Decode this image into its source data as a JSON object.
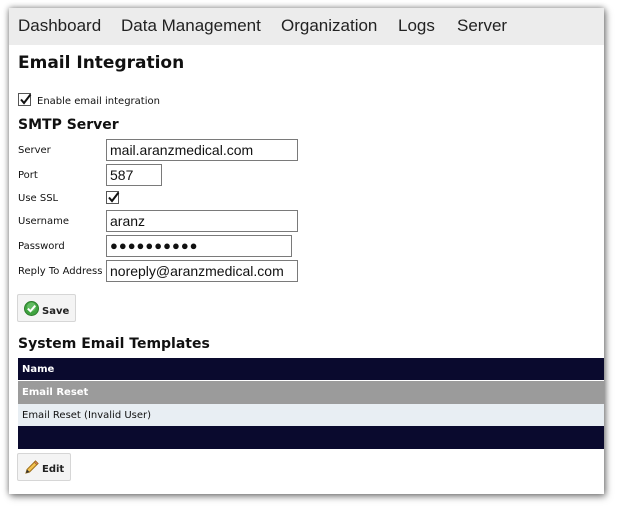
{
  "nav": {
    "items": [
      "Dashboard",
      "Data Management",
      "Organization",
      "Logs",
      "Server"
    ]
  },
  "page": {
    "title": "Email Integration"
  },
  "enable": {
    "label": "Enable email integration",
    "checked": true
  },
  "smtp": {
    "title": "SMTP Server",
    "server_label": "Server",
    "server_value": "mail.aranzmedical.com",
    "port_label": "Port",
    "port_value": "587",
    "ssl_label": "Use SSL",
    "ssl_checked": true,
    "username_label": "Username",
    "username_value": "aranz",
    "password_label": "Password",
    "password_value": "●●●●●●●●●●",
    "reply_label": "Reply To Address",
    "reply_value": "noreply@aranzmedical.com"
  },
  "save_button": {
    "label": "Save",
    "icon": "checkmark-circle-icon",
    "icon_color": "#3fa33f"
  },
  "templates": {
    "title": "System Email Templates",
    "column": "Name",
    "rows": [
      "Email Reset",
      "Email Reset (Invalid User)"
    ],
    "selected_index": 0
  },
  "edit_button": {
    "label": "Edit",
    "icon": "pencil-icon"
  },
  "colors": {
    "nav_bg": "#ececec",
    "table_header": "#0a0a2e",
    "row_selected": "#9b9b9b",
    "row_plain": "#e8eef3"
  }
}
